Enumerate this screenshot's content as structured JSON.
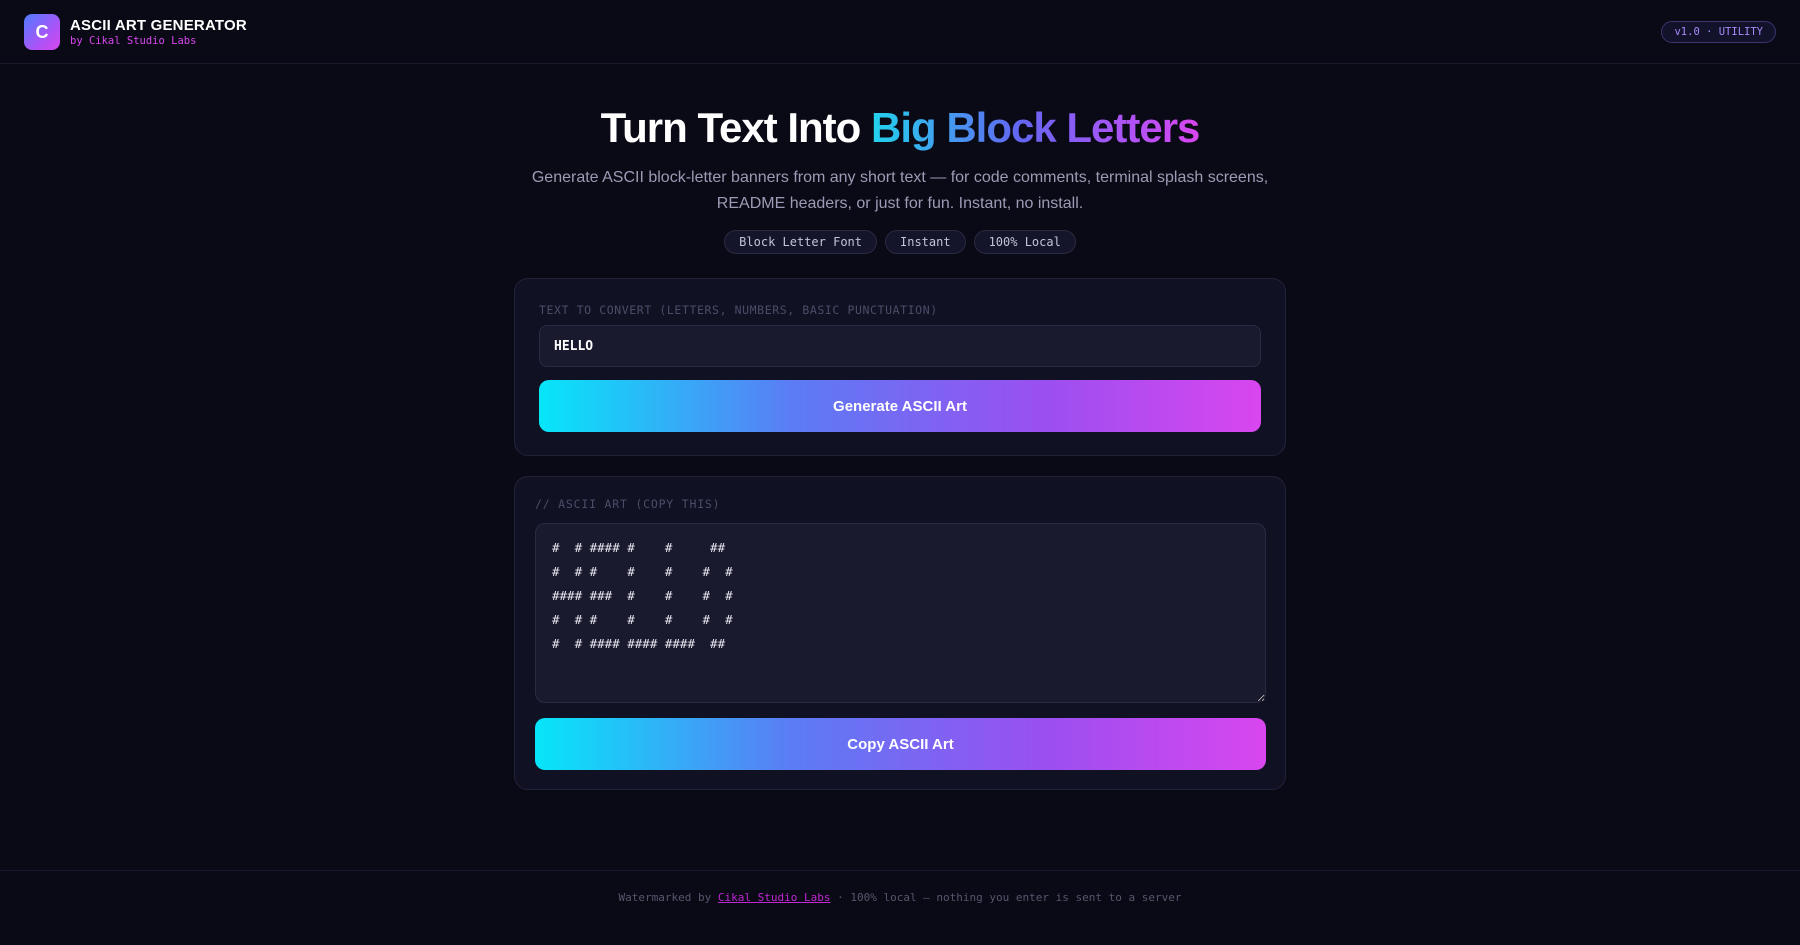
{
  "header": {
    "logo_letter": "C",
    "title": "ASCII ART GENERATOR",
    "subtitle": "by Cikal Studio Labs",
    "version_pill": "v1.0 · UTILITY"
  },
  "hero": {
    "title_plain": "Turn Text Into ",
    "title_accent": "Big Block Letters",
    "description": "Generate ASCII block-letter banners from any short text — for code comments, terminal splash screens, README headers, or just for fun. Instant, no install.",
    "chips": [
      "Block Letter Font",
      "Instant",
      "100% Local"
    ]
  },
  "input_card": {
    "label": "TEXT TO CONVERT (LETTERS, NUMBERS, BASIC PUNCTUATION)",
    "value": "HELLO",
    "button": "Generate ASCII Art"
  },
  "output_card": {
    "label": "// ASCII ART (COPY THIS)",
    "ascii": "#  # #### #    #     ##\n#  # #    #    #    #  #\n#### ###  #    #    #  #\n#  # #    #    #    #  #\n#  # #### #### ####  ##",
    "button": "Copy ASCII Art"
  },
  "footer": {
    "prefix": "Watermarked by ",
    "link": "Cikal Studio Labs",
    "suffix": " · 100% local — nothing you enter is sent to a server"
  },
  "colors": {
    "background": "#0a0a16",
    "card": "#111124",
    "accent_cyan": "#06e6f9",
    "accent_magenta": "#d946ef",
    "accent_purple": "#a855f7"
  }
}
